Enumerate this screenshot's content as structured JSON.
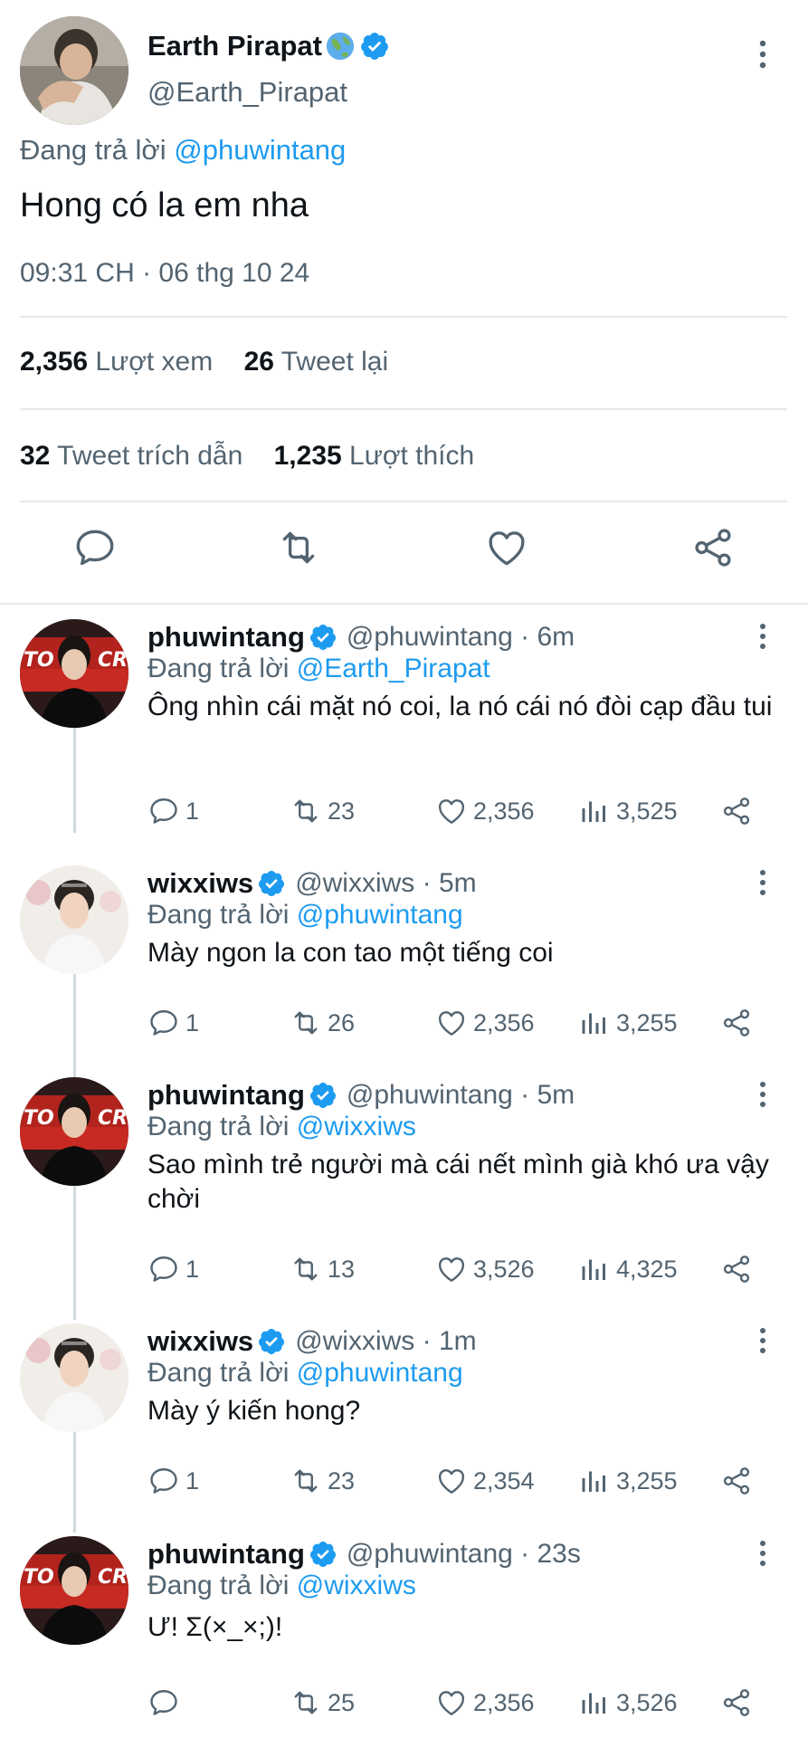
{
  "main_tweet": {
    "name": "Earth Pirapat",
    "handle": "@Earth_Pirapat",
    "reply_prefix": "Đang trả lời",
    "reply_to": "@phuwintang",
    "text": "Hong có la em nha",
    "timestamp": "09:31 CH · 06 thg 10 24",
    "stats": {
      "views_count": "2,356",
      "views_label": "Lượt xem",
      "retweets_count": "26",
      "retweets_label": "Tweet lại",
      "quotes_count": "32",
      "quotes_label": "Tweet trích dẫn",
      "likes_count": "1,235",
      "likes_label": "Lượt thích"
    }
  },
  "replies": [
    {
      "name": "phuwintang",
      "handle_time": "@phuwintang · 6m",
      "reply_prefix": "Đang trả lời",
      "reply_to": "@Earth_Pirapat",
      "text": "Ông nhìn cái mặt nó coi, la nó cái nó đòi cạp đầu tui",
      "replies": "1",
      "retweets": "23",
      "likes": "2,356",
      "views": "3,525"
    },
    {
      "name": "wixxiws",
      "handle_time": "@wixxiws · 5m",
      "reply_prefix": "Đang trả lời",
      "reply_to": "@phuwintang",
      "text": "Mày ngon la con tao một tiếng coi",
      "replies": "1",
      "retweets": "26",
      "likes": "2,356",
      "views": "3,255"
    },
    {
      "name": "phuwintang",
      "handle_time": "@phuwintang · 5m",
      "reply_prefix": "Đang trả lời",
      "reply_to": "@wixxiws",
      "text": "Sao mình trẻ người mà cái nết mình già khó ưa vậy chời",
      "replies": "1",
      "retweets": "13",
      "likes": "3,526",
      "views": "4,325"
    },
    {
      "name": "wixxiws",
      "handle_time": "@wixxiws · 1m",
      "reply_prefix": "Đang trả lời",
      "reply_to": "@phuwintang",
      "text": "Mày ý kiến hong?",
      "replies": "1",
      "retweets": "23",
      "likes": "2,354",
      "views": "3,255"
    },
    {
      "name": "phuwintang",
      "handle_time": "@phuwintang · 23s",
      "reply_prefix": "Đang trả lời",
      "reply_to": "@wixxiws",
      "text": "Ư!  Σ(×_×;)!",
      "replies": "",
      "retweets": "25",
      "likes": "2,356",
      "views": "3,526"
    }
  ],
  "colors": {
    "accent": "#1d9bf0",
    "secondary_text": "#536471",
    "primary_text": "#0f1419",
    "divider": "#e6e9ec"
  }
}
